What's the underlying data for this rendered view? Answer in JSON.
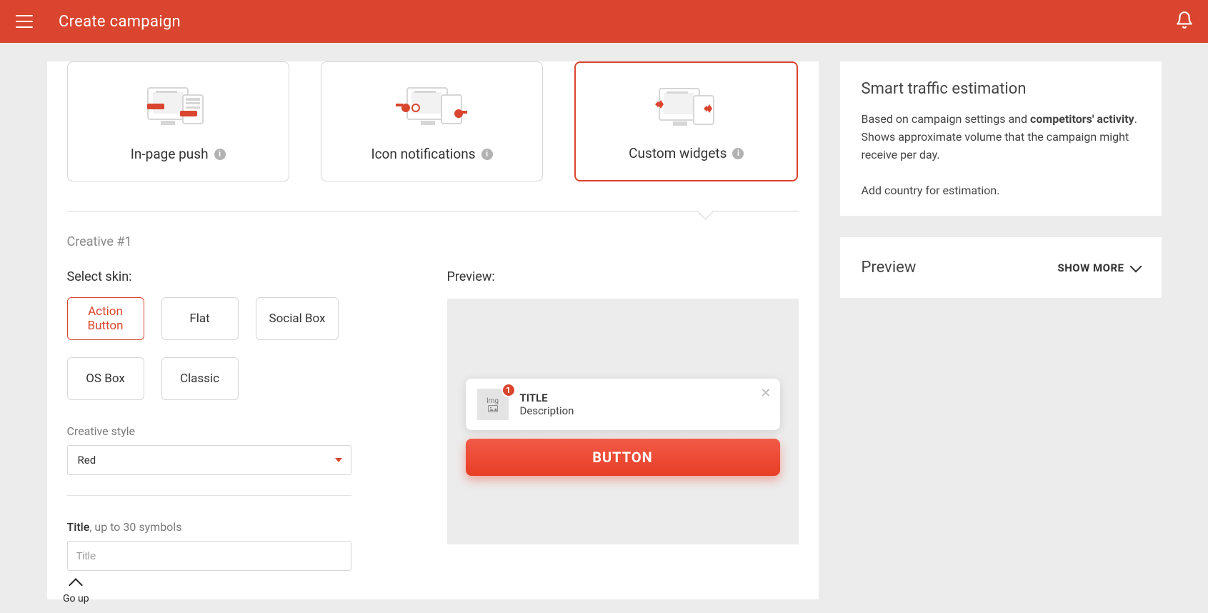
{
  "colors": {
    "accent": "#d9452e"
  },
  "header": {
    "title": "Create campaign"
  },
  "formats": {
    "items": [
      {
        "label": "In-page push"
      },
      {
        "label": "Icon notifications"
      },
      {
        "label": "Custom widgets"
      }
    ]
  },
  "creative": {
    "label": "Creative #1",
    "select_skin_label": "Select skin:",
    "skins": {
      "row1": [
        {
          "label": "Action\nButton"
        },
        {
          "label": "Flat"
        },
        {
          "label": "Social Box"
        }
      ],
      "row2": [
        {
          "label": "OS Box"
        },
        {
          "label": "Classic"
        }
      ]
    },
    "style": {
      "caption": "Creative style",
      "value": "Red"
    },
    "title_field": {
      "caption_dark": "Title",
      "caption_rest": ", up to 30 symbols",
      "placeholder": "Title"
    }
  },
  "preview": {
    "label": "Preview:",
    "img_label": "Img",
    "badge": "1",
    "title": "TITLE",
    "description": "Description",
    "button": "BUTTON"
  },
  "estimation": {
    "title": "Smart traffic estimation",
    "body_pre": "Based on campaign settings and ",
    "body_bold": "competitors' activity",
    "body_post": ". Shows approximate volume that the campaign might receive per day.",
    "note": "Add country for estimation."
  },
  "side_preview": {
    "title": "Preview",
    "show_more": "SHOW MORE"
  },
  "go_up": {
    "label": "Go up"
  }
}
